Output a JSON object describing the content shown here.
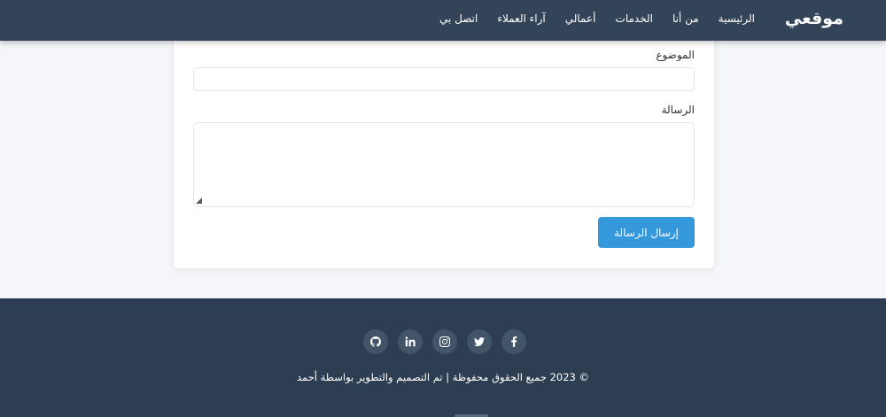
{
  "navbar": {
    "brand": "موقعي",
    "links": [
      "الرئيسية",
      "من أنا",
      "الخدمات",
      "أعمالي",
      "آراء العملاء",
      "اتصل بي"
    ]
  },
  "form": {
    "subject_label": "الموضوع",
    "subject_value": "",
    "message_label": "الرسالة",
    "message_value": "",
    "submit_label": "إرسال الرسالة"
  },
  "footer": {
    "social_icons": [
      "facebook-icon",
      "twitter-icon",
      "instagram-icon",
      "linkedin-icon",
      "github-icon"
    ],
    "copyright": "© 2023 جميع الحقوق محفوظة | تم التصميم والتطوير بواسطة أحمد"
  },
  "colors": {
    "navbar": "#344458",
    "footer": "#2e3e52",
    "accent": "#3498db",
    "social_bg": "#435468"
  }
}
